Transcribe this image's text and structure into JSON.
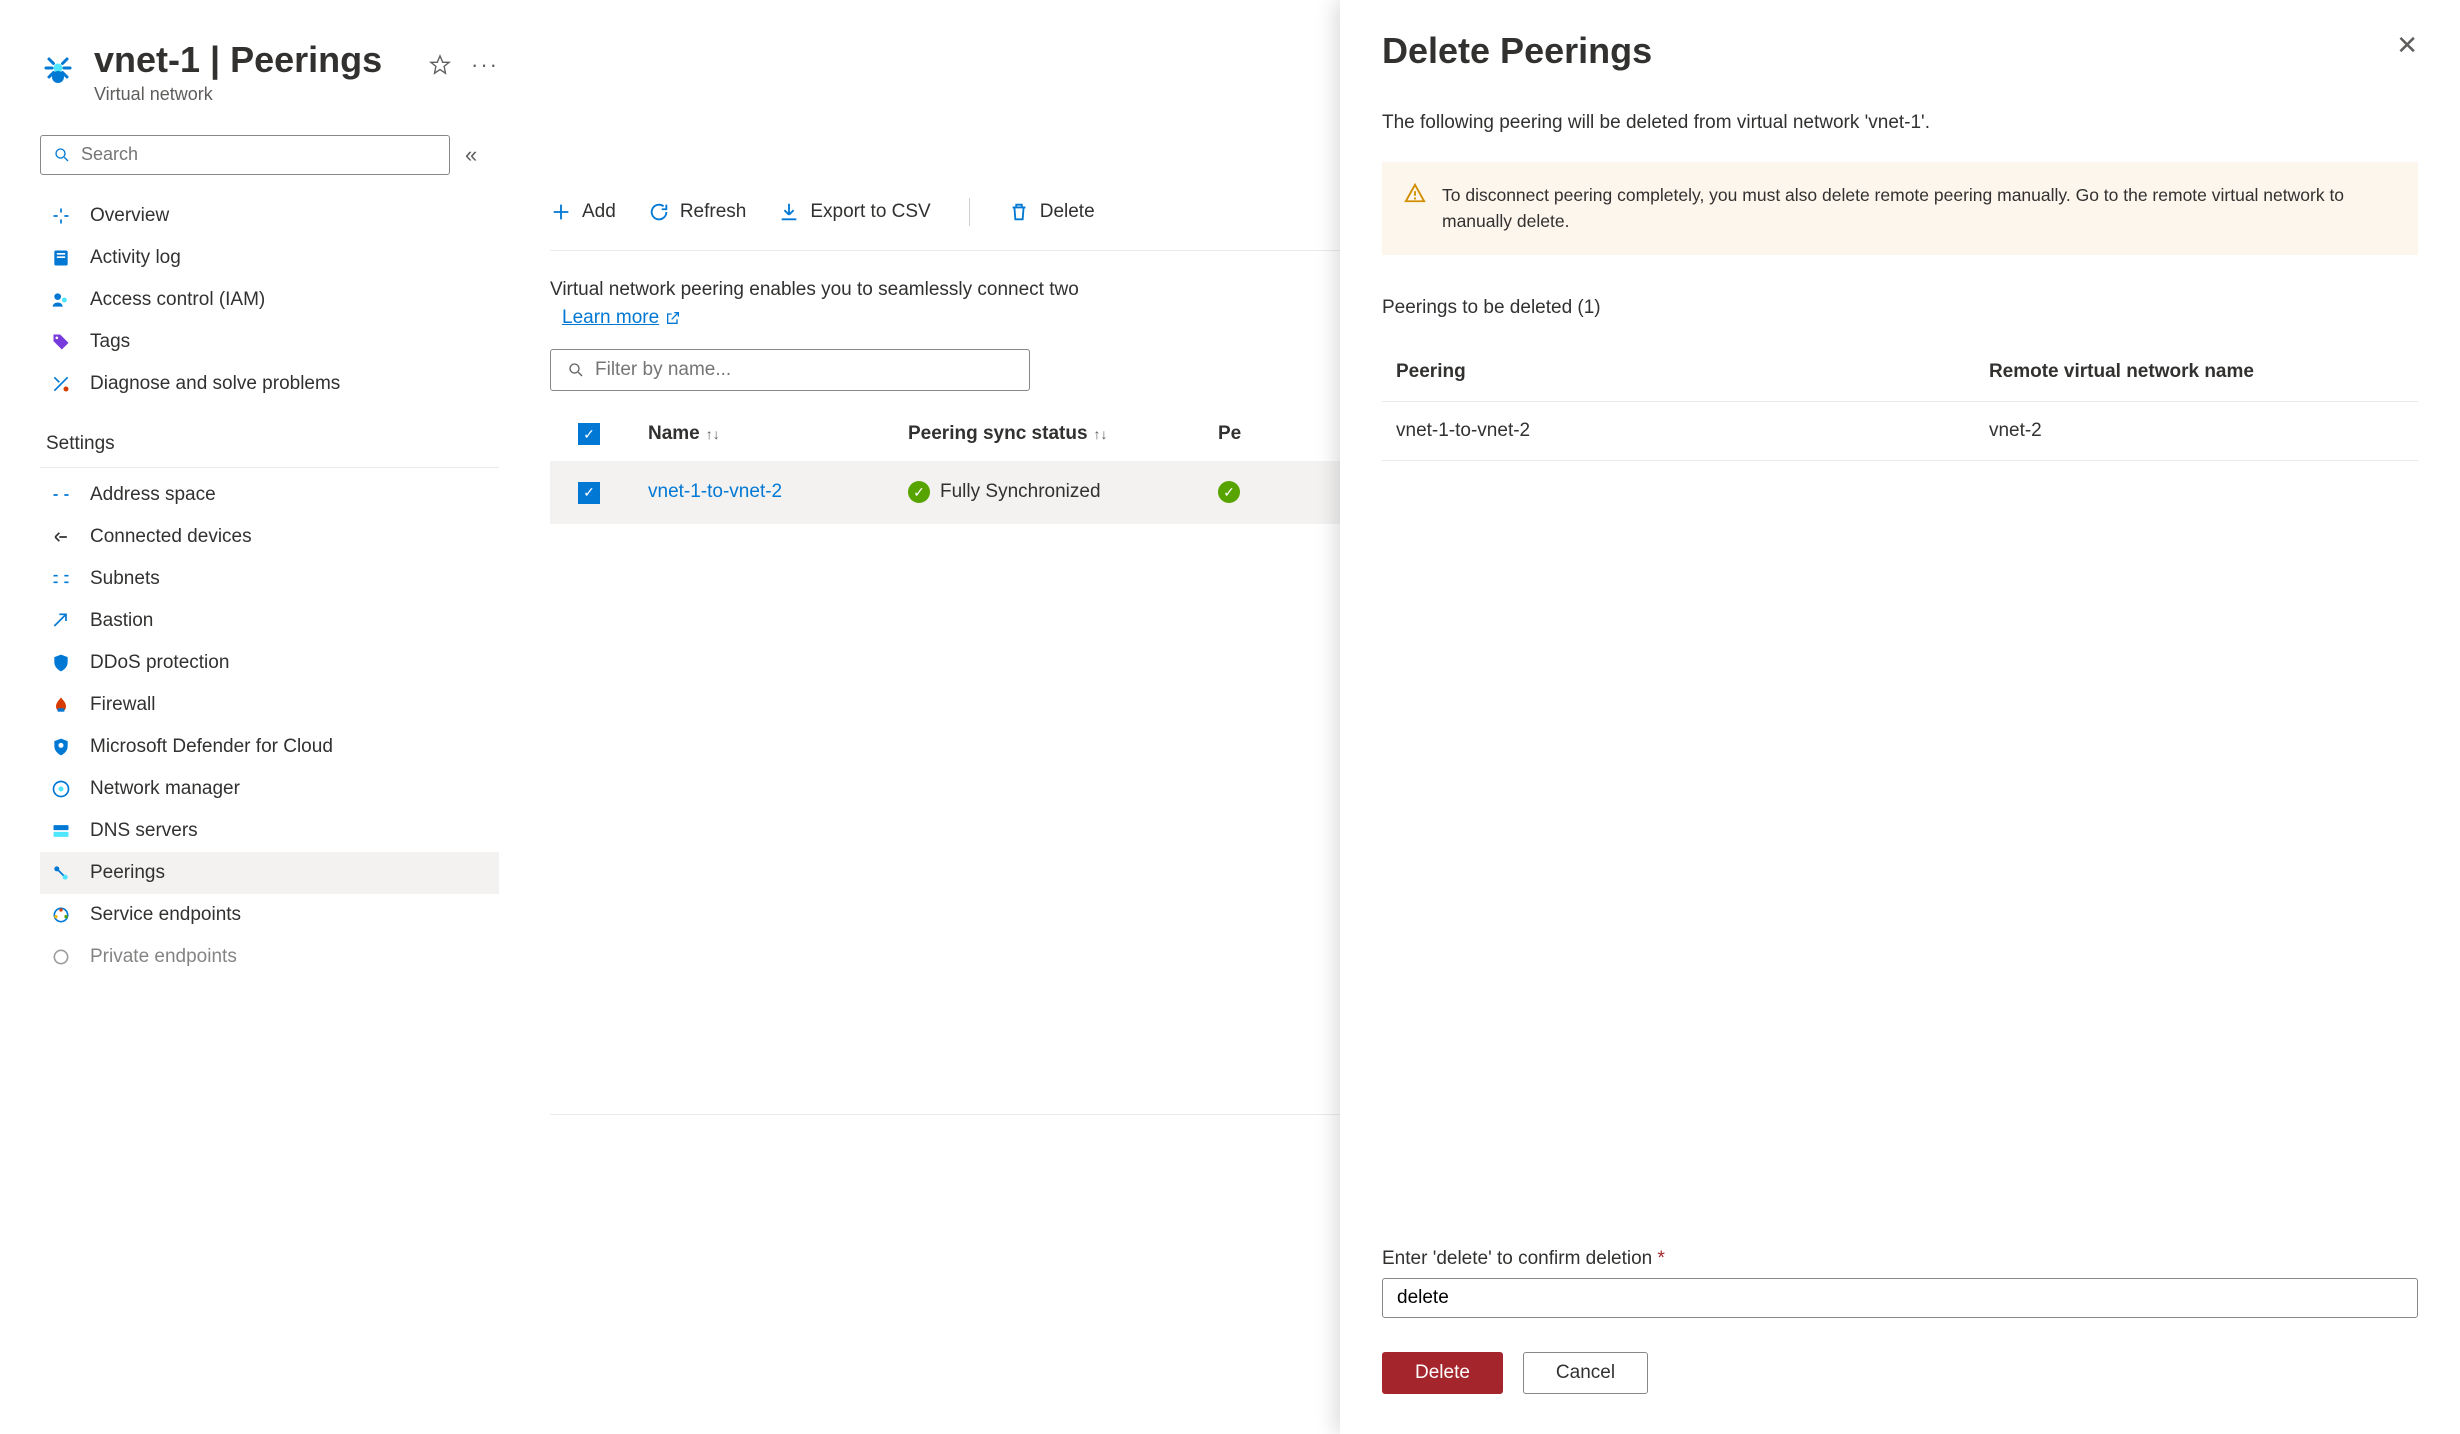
{
  "header": {
    "title": "vnet-1 | Peerings",
    "subtitle": "Virtual network"
  },
  "search": {
    "placeholder": "Search"
  },
  "nav_top": [
    {
      "label": "Overview",
      "name": "overview"
    },
    {
      "label": "Activity log",
      "name": "activity-log"
    },
    {
      "label": "Access control (IAM)",
      "name": "access-control"
    },
    {
      "label": "Tags",
      "name": "tags"
    },
    {
      "label": "Diagnose and solve problems",
      "name": "diagnose"
    }
  ],
  "nav_section_title": "Settings",
  "nav_settings": [
    {
      "label": "Address space",
      "name": "address-space"
    },
    {
      "label": "Connected devices",
      "name": "connected-devices"
    },
    {
      "label": "Subnets",
      "name": "subnets"
    },
    {
      "label": "Bastion",
      "name": "bastion"
    },
    {
      "label": "DDoS protection",
      "name": "ddos-protection"
    },
    {
      "label": "Firewall",
      "name": "firewall"
    },
    {
      "label": "Microsoft Defender for Cloud",
      "name": "defender"
    },
    {
      "label": "Network manager",
      "name": "network-manager"
    },
    {
      "label": "DNS servers",
      "name": "dns-servers"
    },
    {
      "label": "Peerings",
      "name": "peerings",
      "selected": true
    },
    {
      "label": "Service endpoints",
      "name": "service-endpoints"
    },
    {
      "label": "Private endpoints",
      "name": "private-endpoints"
    }
  ],
  "toolbar": {
    "add": "Add",
    "refresh": "Refresh",
    "export": "Export to CSV",
    "delete": "Delete"
  },
  "intro": "Virtual network peering enables you to seamlessly connect two",
  "learn_more": "Learn more",
  "filter_placeholder": "Filter by name...",
  "columns": {
    "name": "Name",
    "sync": "Peering sync status",
    "status": "Pe"
  },
  "rows": [
    {
      "name": "vnet-1-to-vnet-2",
      "sync": "Fully Synchronized"
    }
  ],
  "panel": {
    "title": "Delete Peerings",
    "description": "The following peering will be deleted from virtual network 'vnet-1'.",
    "warning": "To disconnect peering completely, you must also delete remote peering manually. Go to the remote virtual network to manually delete.",
    "subheading": "Peerings to be deleted (1)",
    "col_peering": "Peering",
    "col_remote": "Remote virtual network name",
    "rows": [
      {
        "peering": "vnet-1-to-vnet-2",
        "remote": "vnet-2"
      }
    ],
    "confirm_label": "Enter 'delete' to confirm deletion",
    "confirm_value": "delete",
    "btn_delete": "Delete",
    "btn_cancel": "Cancel"
  }
}
